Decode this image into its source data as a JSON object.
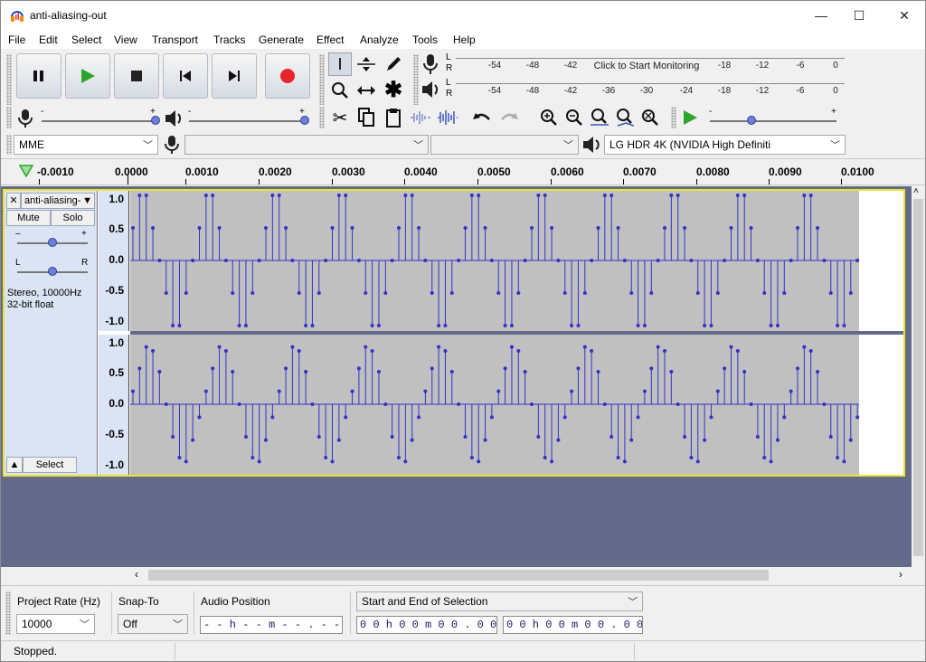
{
  "window": {
    "title": "anti-aliasing-out",
    "minimize": "—",
    "maximize": "☐",
    "close": "✕"
  },
  "menu": [
    "File",
    "Edit",
    "Select",
    "View",
    "Transport",
    "Tracks",
    "Generate",
    "Effect",
    "Analyze",
    "Tools",
    "Help"
  ],
  "meters": {
    "record_scale": [
      "-54",
      "-48",
      "-42",
      "-18",
      "-12",
      "-6",
      "0"
    ],
    "record_prompt": "Click to Start Monitoring",
    "play_scale": [
      "-54",
      "-48",
      "-42",
      "-36",
      "-30",
      "-24",
      "-18",
      "-12",
      "-6",
      "0"
    ],
    "lr_l": "L",
    "lr_r": "R"
  },
  "sliders": {
    "minus": "-",
    "plus": "+"
  },
  "device": {
    "host": "MME",
    "recording_device": "",
    "channels": "",
    "playback_device": "LG HDR 4K (NVIDIA High Definiti"
  },
  "ruler": {
    "labels": [
      "0.0010",
      "0.0000",
      "0.0010",
      "0.0020",
      "0.0030",
      "0.0040",
      "0.0050",
      "0.0060",
      "0.0070",
      "0.0080",
      "0.0090",
      "0.0100"
    ],
    "first_label": "0.0010",
    "minus_sign": "-"
  },
  "track": {
    "name": "anti-aliasing-",
    "close": "✕",
    "menu_arrow": "▼",
    "mute": "Mute",
    "solo": "Solo",
    "gain_minus": "–",
    "gain_plus": "+",
    "pan_l": "L",
    "pan_r": "R",
    "info_line1": "Stereo, 10000Hz",
    "info_line2": "32-bit float",
    "collapse": "▲",
    "select": "Select",
    "vscale": [
      "1.0",
      "0.5",
      "0.0",
      "-0.5",
      "-1.0"
    ],
    "channels": [
      {
        "name": "left",
        "period_samples": 8,
        "pattern": [
          0.5,
          1.0,
          1.0,
          0.5,
          0.0,
          -0.5,
          -1.0,
          -1.0,
          -0.5,
          0.0
        ]
      },
      {
        "name": "right",
        "period_samples": 8,
        "pattern": [
          0.2,
          0.55,
          0.88,
          0.82,
          0.5,
          0.0,
          -0.5,
          -0.82,
          -0.88,
          -0.55,
          -0.2
        ]
      }
    ]
  },
  "selection_toolbar": {
    "project_rate_label": "Project Rate (Hz)",
    "project_rate_value": "10000",
    "snap_label": "Snap-To",
    "snap_value": "Off",
    "audio_position_label": "Audio Position",
    "audio_position_value": "- - h - - m - - . - - - s",
    "selection_mode": "Start and End of Selection",
    "selection_start": "0 0 h 0 0 m 0 0 . 0 0 0 s",
    "selection_end": "0 0 h 0 0 m 0 0 . 0 0 0 s"
  },
  "status": {
    "text": "Stopped."
  },
  "colors": {
    "waveform": "#3232c8",
    "track_border": "#ece32e",
    "background": "#636a8a",
    "record": "#e8262a",
    "play": "#2aa52a"
  }
}
